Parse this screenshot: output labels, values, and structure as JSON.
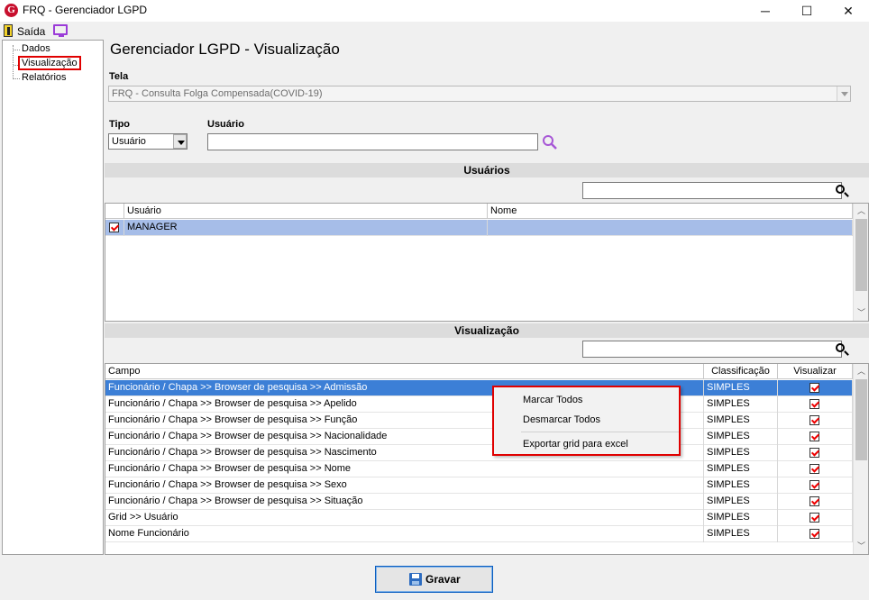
{
  "window": {
    "title": "FRQ - Gerenciador LGPD",
    "app_icon": "G",
    "minimize_icon": "─",
    "maximize_icon": "☐",
    "close_icon": "✕"
  },
  "menu": {
    "exit_label": "Saída"
  },
  "tree": {
    "items": [
      "Dados",
      "Visualização",
      "Relatórios"
    ],
    "selected": "Visualização"
  },
  "main": {
    "title": "Gerenciador LGPD - Visualização",
    "tela_label": "Tela",
    "tela_value": "FRQ - Consulta Folga Compensada(COVID-19)",
    "tipo_label": "Tipo",
    "tipo_value": "Usuário",
    "usuario_label": "Usuário",
    "usuario_value": ""
  },
  "usuarios_section": {
    "title": "Usuários",
    "columns": [
      "Usuário",
      "Nome"
    ],
    "rows": [
      {
        "checked": true,
        "usuario": "MANAGER",
        "nome": ""
      }
    ]
  },
  "visualizacao_section": {
    "title": "Visualização",
    "columns": [
      "Campo",
      "Classificação",
      "Visualizar"
    ],
    "rows": [
      {
        "campo": "Funcionário / Chapa >> Browser de pesquisa >> Admissão",
        "classificacao": "SIMPLES",
        "visualizar": true
      },
      {
        "campo": "Funcionário / Chapa >> Browser de pesquisa >> Apelido",
        "classificacao": "SIMPLES",
        "visualizar": true
      },
      {
        "campo": "Funcionário / Chapa >> Browser de pesquisa >> Função",
        "classificacao": "SIMPLES",
        "visualizar": true
      },
      {
        "campo": "Funcionário / Chapa >> Browser de pesquisa >> Nacionalidade",
        "classificacao": "SIMPLES",
        "visualizar": true
      },
      {
        "campo": "Funcionário / Chapa >> Browser de pesquisa >> Nascimento",
        "classificacao": "SIMPLES",
        "visualizar": true
      },
      {
        "campo": "Funcionário / Chapa >> Browser de pesquisa >> Nome",
        "classificacao": "SIMPLES",
        "visualizar": true
      },
      {
        "campo": "Funcionário / Chapa >> Browser de pesquisa >> Sexo",
        "classificacao": "SIMPLES",
        "visualizar": true
      },
      {
        "campo": "Funcionário / Chapa >> Browser de pesquisa >> Situação",
        "classificacao": "SIMPLES",
        "visualizar": true
      },
      {
        "campo": "Grid >> Usuário",
        "classificacao": "SIMPLES",
        "visualizar": true
      },
      {
        "campo": "Nome Funcionário",
        "classificacao": "SIMPLES",
        "visualizar": true
      }
    ]
  },
  "context_menu": {
    "items": [
      "Marcar Todos",
      "Desmarcar Todos",
      "Exportar grid para excel"
    ]
  },
  "footer": {
    "save_label": "Gravar"
  },
  "colors": {
    "selection": "#3c7fd6",
    "highlight_border": "#e00000",
    "accent_purple": "#9b3cd8"
  }
}
